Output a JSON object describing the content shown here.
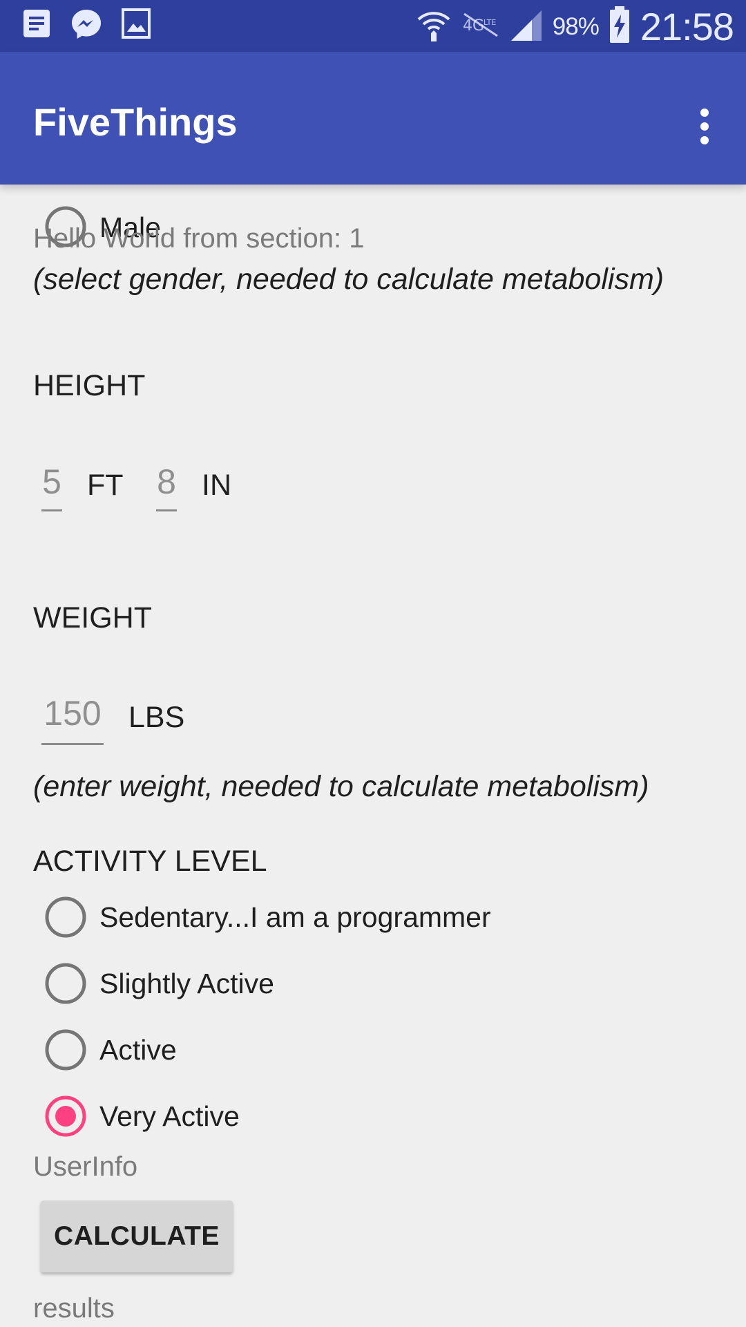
{
  "status_bar": {
    "battery": "98%",
    "time": "21:58",
    "left_icons": [
      "notes-icon",
      "messenger-icon",
      "image-icon"
    ],
    "right_icons": [
      "wifi-icon",
      "no-lte-icon",
      "signal-icon",
      "battery-charging-icon"
    ]
  },
  "app_bar": {
    "title": "FiveThings",
    "menu_icon": "more-vert-icon"
  },
  "gender": {
    "male_label": "Male",
    "male_selected": false,
    "section_text": "Hello World from section: 1",
    "hint": "(select gender, needed to calculate metabolism)"
  },
  "height": {
    "heading": "HEIGHT",
    "feet_value": "5",
    "feet_unit": "FT",
    "inches_value": "8",
    "inches_unit": "IN"
  },
  "weight": {
    "heading": "WEIGHT",
    "value": "150",
    "unit": "LBS",
    "hint": "(enter weight, needed to calculate metabolism)"
  },
  "activity": {
    "heading": "ACTIVITY LEVEL",
    "options": [
      {
        "label": "Sedentary...I am a programmer",
        "selected": false
      },
      {
        "label": "Slightly Active",
        "selected": false
      },
      {
        "label": "Active",
        "selected": false
      },
      {
        "label": "Very Active",
        "selected": true
      }
    ]
  },
  "user_info_label": "UserInfo",
  "calculate_label": "CALCULATE",
  "results_label": "results",
  "colors": {
    "status_bar": "#2f3f9e",
    "app_bar": "#3f51b5",
    "background": "#efefef",
    "accent": "#ff4081",
    "radio_off": "#757575"
  }
}
